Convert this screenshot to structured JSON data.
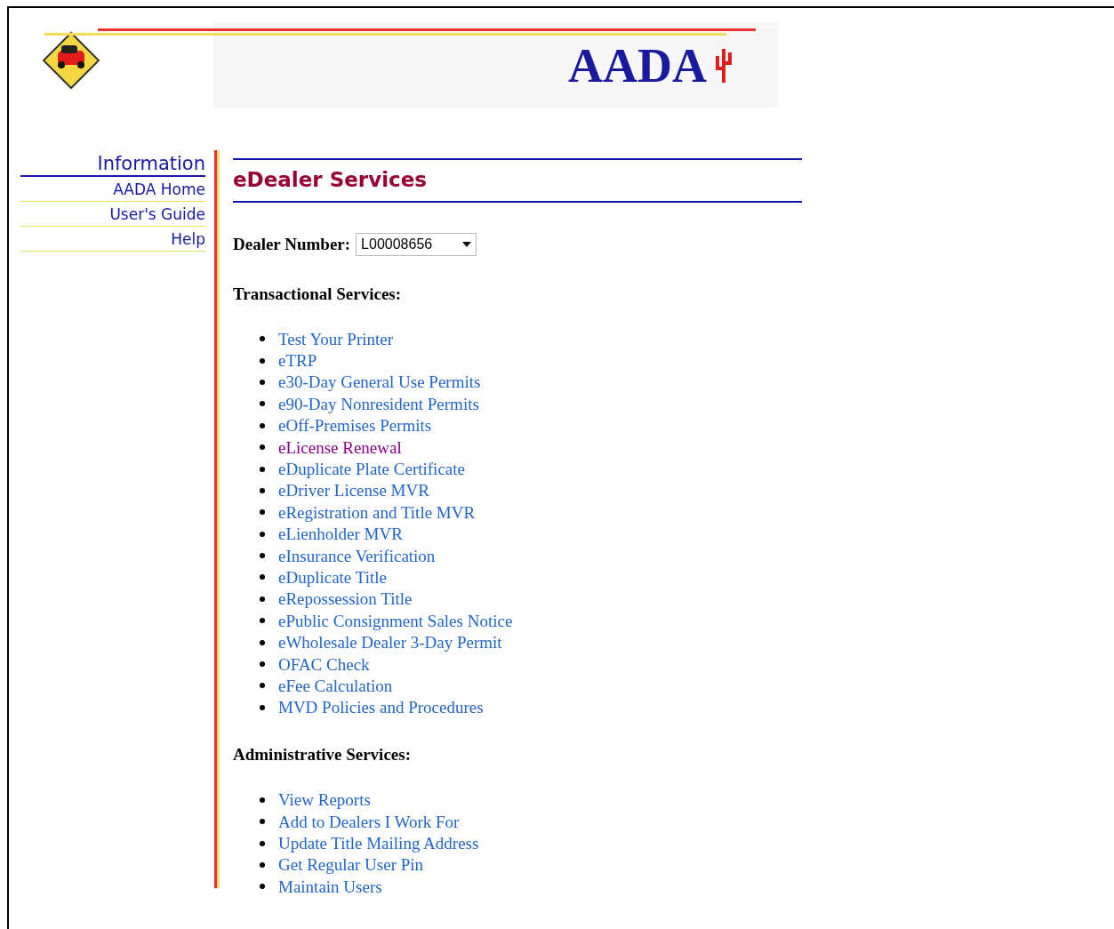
{
  "banner": {
    "logo_text": "AADA"
  },
  "sidebar": {
    "title": "Information",
    "items": [
      "AADA Home",
      "User's Guide",
      "Help"
    ]
  },
  "main": {
    "title": "eDealer Services",
    "dealer_number": {
      "label": "Dealer Number:",
      "value": "L00008656"
    },
    "sections": [
      {
        "heading": "Transactional Services:",
        "links": [
          {
            "label": "Test Your Printer",
            "visited": false
          },
          {
            "label": "eTRP",
            "visited": false
          },
          {
            "label": "e30-Day General Use Permits",
            "visited": false
          },
          {
            "label": "e90-Day Nonresident Permits",
            "visited": false
          },
          {
            "label": "eOff-Premises Permits",
            "visited": false
          },
          {
            "label": "eLicense Renewal",
            "visited": true
          },
          {
            "label": "eDuplicate Plate Certificate",
            "visited": false
          },
          {
            "label": "eDriver License MVR",
            "visited": false
          },
          {
            "label": "eRegistration and Title MVR",
            "visited": false
          },
          {
            "label": "eLienholder MVR",
            "visited": false
          },
          {
            "label": "eInsurance Verification",
            "visited": false
          },
          {
            "label": "eDuplicate Title",
            "visited": false
          },
          {
            "label": "eRepossession Title",
            "visited": false
          },
          {
            "label": "ePublic Consignment Sales Notice",
            "visited": false
          },
          {
            "label": "eWholesale Dealer 3-Day Permit",
            "visited": false
          },
          {
            "label": "OFAC Check",
            "visited": false
          },
          {
            "label": "eFee Calculation",
            "visited": false
          },
          {
            "label": "MVD Policies and Procedures",
            "visited": false
          }
        ]
      },
      {
        "heading": "Administrative Services:",
        "links": [
          {
            "label": "View Reports",
            "visited": false
          },
          {
            "label": "Add to Dealers I Work For",
            "visited": false
          },
          {
            "label": "Update Title Mailing Address",
            "visited": false
          },
          {
            "label": "Get Regular User Pin",
            "visited": false
          },
          {
            "label": "Maintain Users",
            "visited": false
          }
        ]
      }
    ]
  }
}
